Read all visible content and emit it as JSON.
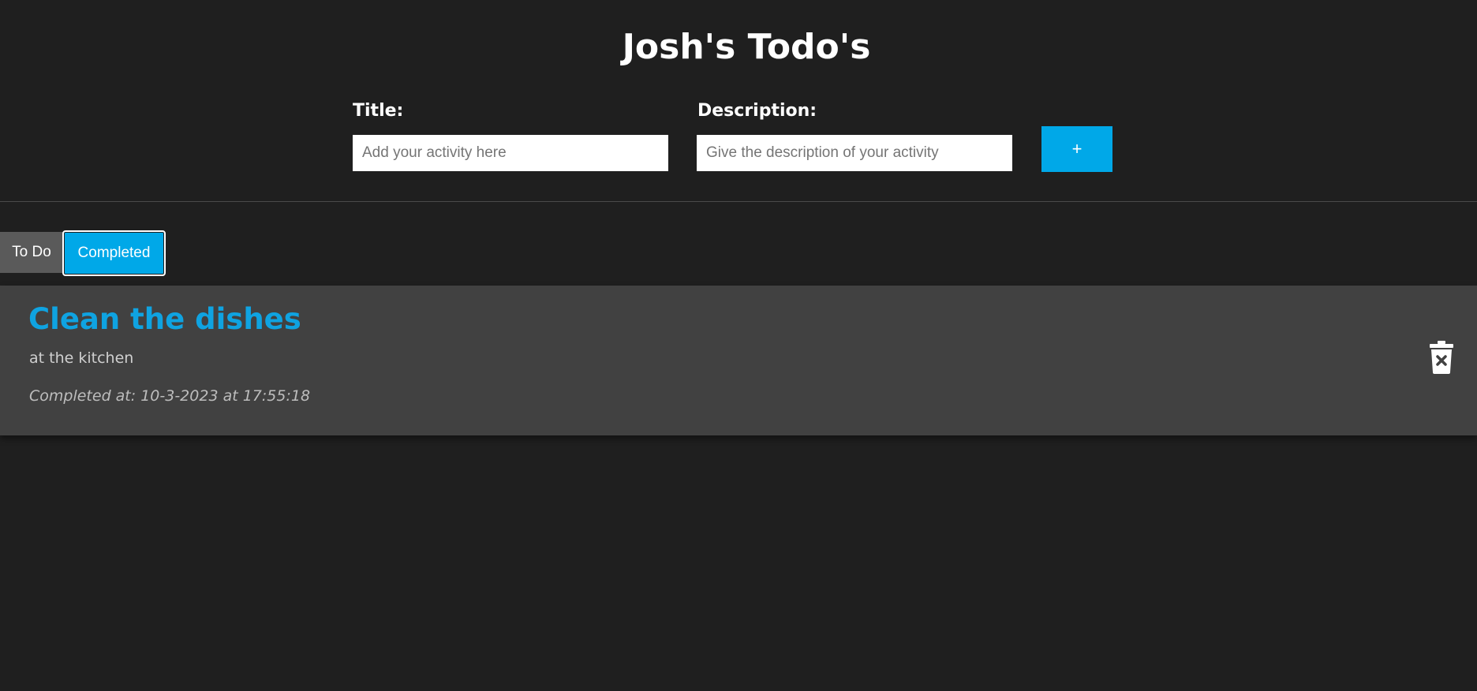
{
  "header": {
    "title": "Josh's Todo's"
  },
  "form": {
    "title_label": "Title:",
    "title_placeholder": "Add your activity here",
    "title_value": "",
    "description_label": "Description:",
    "description_placeholder": "Give the description of your activity",
    "description_value": "",
    "add_button_label": "+"
  },
  "tabs": [
    {
      "label": "To Do",
      "active": false
    },
    {
      "label": "Completed",
      "active": true
    }
  ],
  "todos": [
    {
      "title": "Clean the dishes",
      "description": "at the kitchen",
      "completed_text": "Completed at: 10-3-2023 at 17:55:18",
      "delete_icon": "trash-x-icon"
    }
  ],
  "colors": {
    "background": "#1f1f1f",
    "accent": "#00a8e8",
    "card_background": "#414141",
    "title_accent": "#0fa3e1",
    "inactive_tab": "#5a5a5a"
  }
}
